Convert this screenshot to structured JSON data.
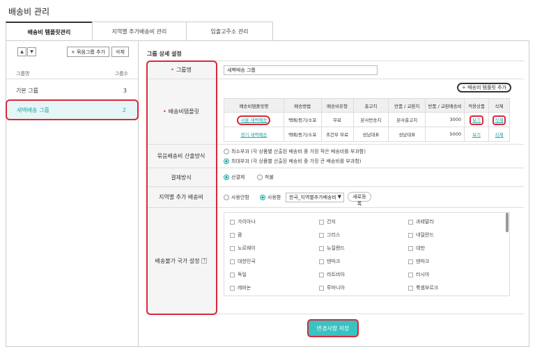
{
  "page_title": "배송비 관리",
  "tabs": [
    {
      "label": "배송비 템플릿관리"
    },
    {
      "label": "지역별 추가배송비 관리"
    },
    {
      "label": "입출고주소 관리"
    }
  ],
  "left": {
    "up_arrow": "▲",
    "down_arrow": "▼",
    "add_group_label": "+ 묶음그룹 추가",
    "delete_label": "삭제",
    "col_name": "그룹명",
    "col_count": "그룹수",
    "groups": [
      {
        "name": "기본 그룹",
        "count": "3"
      },
      {
        "name": "새벽배송 그룹",
        "count": "2"
      }
    ]
  },
  "detail": {
    "title": "그룹 상세 설정",
    "group_name_label": "그룹명",
    "group_name_value": "새벽배송 그룹",
    "template_label": "배송비템플릿",
    "add_template_label": "+ 배송비 템플릿 추가",
    "table_headers": [
      "배송비템플릿명",
      "배송방법",
      "배송비유형",
      "출고지",
      "반품 / 교환지",
      "반품 / 교환배송비",
      "적용상품",
      "삭제"
    ],
    "table_rows": [
      {
        "name": "서울 새벽배송",
        "method": "택배/등기/소포",
        "type": "무료",
        "origin": "본사반송지",
        "return_addr": "본사출고지",
        "return_fee": "3000",
        "products": "보기",
        "delete": "삭제"
      },
      {
        "name": "경기 새벽배송",
        "method": "택배/등기/소포",
        "type": "조건부 무료",
        "origin": "성남대표",
        "return_addr": "성남대표",
        "return_fee": "5000",
        "products": "보기",
        "delete": "삭제"
      }
    ],
    "bundle_label": "묶음배송비 산출방식",
    "bundle_opt1": "최소부과 (각 상품별 산출된 배송비 중 가장 작은 배송비를 부과함)",
    "bundle_opt2": "최대부과 (각 상품별 산출된 배송비 중 가장 큰 배송비를 부과함)",
    "payment_label": "결제방식",
    "payment_opt1": "선결제",
    "payment_opt2": "착불",
    "region_label": "지역별 추가 배송비",
    "region_opt1": "사용안함",
    "region_opt2": "사용함",
    "region_select": "한국_지역별추가배송비",
    "region_new": "새로등록",
    "noship_label": "배송불가 국가 설정",
    "help_icon": "?",
    "countries": [
      "가이아나",
      "건지",
      "과테말라",
      "괌",
      "그리스",
      "네덜란드",
      "노르웨이",
      "뉴질랜드",
      "대만",
      "대한민국",
      "덴마크",
      "덴마크",
      "독일",
      "라트비아",
      "러시아",
      "레바논",
      "루마니아",
      "룩셈부르크"
    ]
  },
  "save_label": "변경사항 저장",
  "colors": {
    "accent": "#39c2c2",
    "highlight": "#d9283a",
    "link": "#1aa3a3"
  }
}
